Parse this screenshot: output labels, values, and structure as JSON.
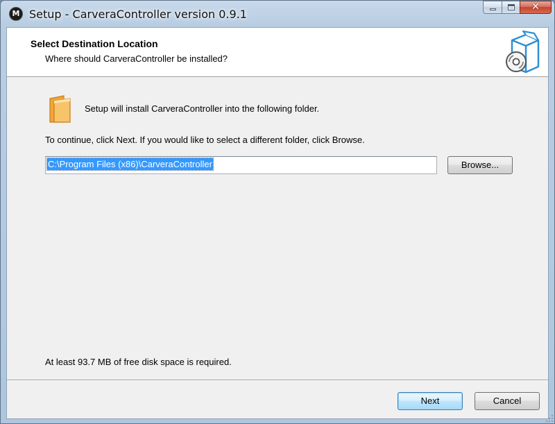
{
  "window": {
    "title": "Setup - CarveraController version 0.9.1",
    "app_icon_glyph": "M",
    "caption": {
      "minimize": "",
      "maximize": "",
      "close": "✕"
    }
  },
  "header": {
    "title": "Select Destination Location",
    "subtitle": "Where should CarveraController be installed?",
    "icon": "setup-box-disc-icon"
  },
  "body": {
    "folder_icon": "folder-icon",
    "folder_text": "Setup will install CarveraController into the following folder.",
    "continue_text": "To continue, click Next. If you would like to select a different folder, click Browse.",
    "install_path": "C:\\Program Files (x86)\\CarveraController",
    "browse_label": "Browse...",
    "disk_space_text": "At least 93.7 MB of free disk space is required."
  },
  "footer": {
    "next_label": "Next",
    "cancel_label": "Cancel"
  },
  "colors": {
    "selection": "#3399ff",
    "close_button": "#c3452e",
    "folder": "#f5b14a"
  }
}
